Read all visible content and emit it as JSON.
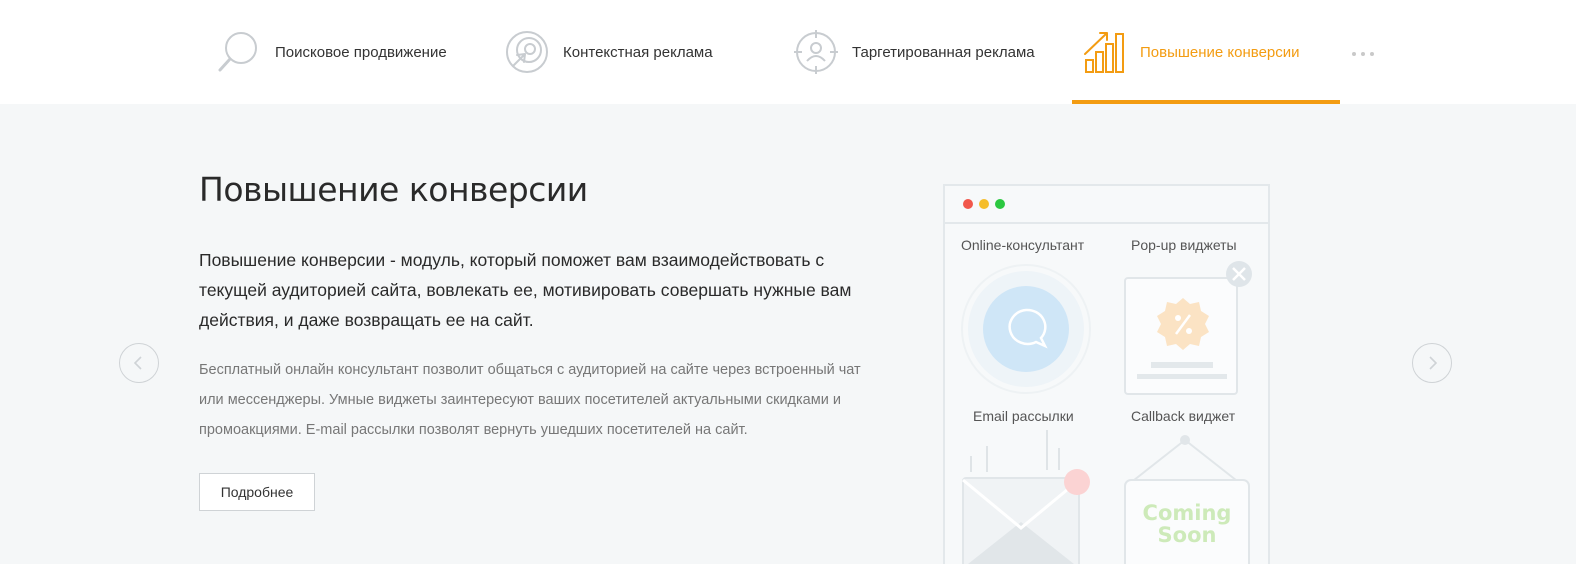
{
  "tabs": [
    {
      "label": "Поисковое продвижение",
      "icon": "magnifier-icon",
      "active": false
    },
    {
      "label": "Контекстная реклама",
      "icon": "target-click-icon",
      "active": false
    },
    {
      "label": "Таргетированная реклама",
      "icon": "user-target-icon",
      "active": false
    },
    {
      "label": "Повышение конверсии",
      "icon": "growth-chart-icon",
      "active": true
    }
  ],
  "more_icon": "ellipsis-icon",
  "colors": {
    "accent": "#f39c12",
    "background": "#f5f7f8",
    "text": "#333333",
    "muted_text": "#777777"
  },
  "content": {
    "title": "Повышение конверсии",
    "lead": "Повышение конверсии - модуль, который поможет вам взаимодействовать с текущей аудиторией сайта, вовлекать ее, мотивировать совершать нужные вам действия, и даже возвращать ее на сайт.",
    "description": "Бесплатный онлайн консультант позволит общаться с аудиторией на сайте через встроенный чат или мессенджеры. Умные виджеты заинтересуют ваших посетителей актуальными скидками и промоакциями. E-mail рассылки позволят вернуть ушедших посетителей на сайт.",
    "more_button": "Подробнее"
  },
  "carousel": {
    "prev_icon": "chevron-left-icon",
    "next_icon": "chevron-right-icon"
  },
  "illustration": {
    "widgets": [
      {
        "label": "Online-консультант",
        "icon": "chat-bubble-icon"
      },
      {
        "label": "Pop-up виджеты",
        "icon": "discount-badge-icon"
      },
      {
        "label": "Email рассылки",
        "icon": "envelope-icon"
      },
      {
        "label": "Callback виджет",
        "icon": "hanging-sign-icon"
      }
    ],
    "callback_sign_text": "Coming Soon"
  }
}
